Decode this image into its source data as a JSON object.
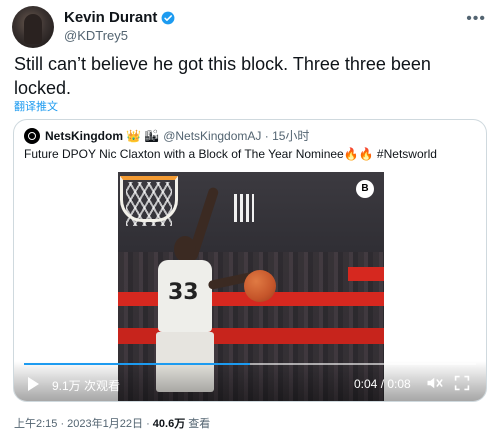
{
  "author": {
    "name": "Kevin Durant",
    "handle": "@KDTrey5",
    "verified": true
  },
  "tweet": {
    "text": "Still can’t believe he got this block. Three three been locked.",
    "translate_label": "翻译推文"
  },
  "quoted": {
    "name": "NetsKingdom",
    "emoji_1": "👑",
    "emoji_2": "🏙",
    "handle_time": "@NetsKingdomAJ · 15小时",
    "text": "Future DPOY Nic Claxton with a Block of The Year Nominee🔥🔥 #Netsworld",
    "jersey_number": "33"
  },
  "video": {
    "views": "9.1万 次观看",
    "time": "0:04 / 0:08",
    "progress_fraction": 0.5,
    "logo_glyph": "B"
  },
  "footer": {
    "time": "上午2:15 · 2023年1月22日 · ",
    "views": "40.6万",
    "views_label": " 查看"
  },
  "colors": {
    "accent": "#1d9bf0",
    "text": "#0f1419",
    "secondary": "#536471",
    "border": "#cfd9de"
  },
  "icons": [
    "verified-badge-icon",
    "more-options-icon",
    "play-icon",
    "volume-icon",
    "fullscreen-icon"
  ]
}
